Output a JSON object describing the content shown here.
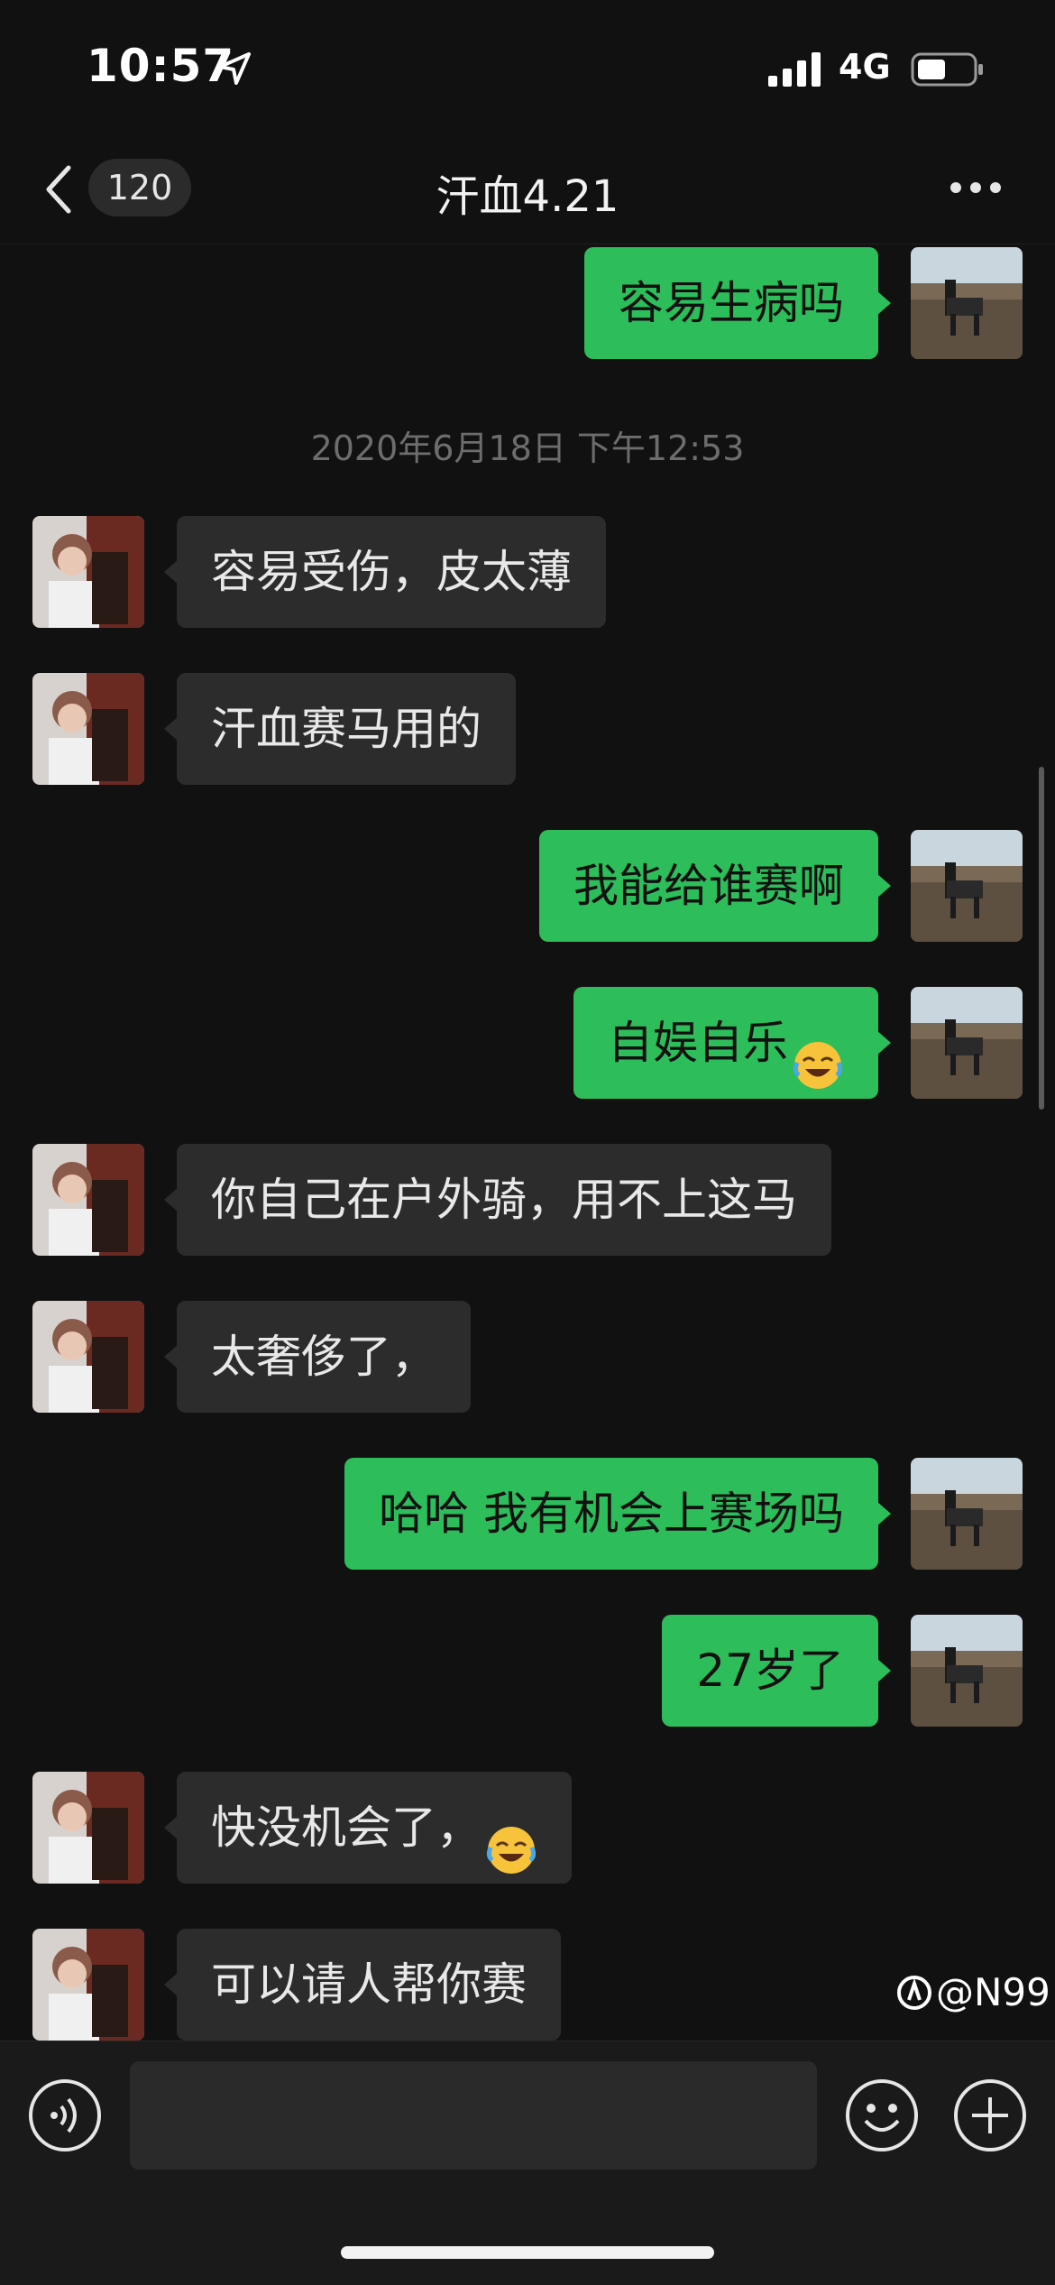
{
  "status_bar": {
    "time": "10:57",
    "network": "4G"
  },
  "nav": {
    "back_count": "120",
    "title": "汗血4.21"
  },
  "chat": {
    "timestamp": "2020年6月18日 下午12:53",
    "messages": [
      {
        "side": "out",
        "text": "容易生病吗"
      },
      {
        "side": "in",
        "text": "容易受伤，皮太薄"
      },
      {
        "side": "in",
        "text": "汗血赛马用的"
      },
      {
        "side": "out",
        "text": "我能给谁赛啊"
      },
      {
        "side": "out",
        "text": "自娱自乐",
        "emoji": "crying-laughing-emoji"
      },
      {
        "side": "in",
        "text": "你自己在户外骑，用不上这马"
      },
      {
        "side": "in",
        "text": "太奢侈了，"
      },
      {
        "side": "out",
        "text": "哈哈 我有机会上赛场吗"
      },
      {
        "side": "out",
        "text": "27岁了"
      },
      {
        "side": "in",
        "text": "快没机会了，",
        "emoji": "crying-laughing-emoji"
      },
      {
        "side": "in",
        "text": "可以请人帮你赛"
      }
    ]
  },
  "watermark": "@N99",
  "colors": {
    "background": "#111111",
    "bubble_out": "#2dbd5b",
    "bubble_in": "#2c2c2c"
  }
}
